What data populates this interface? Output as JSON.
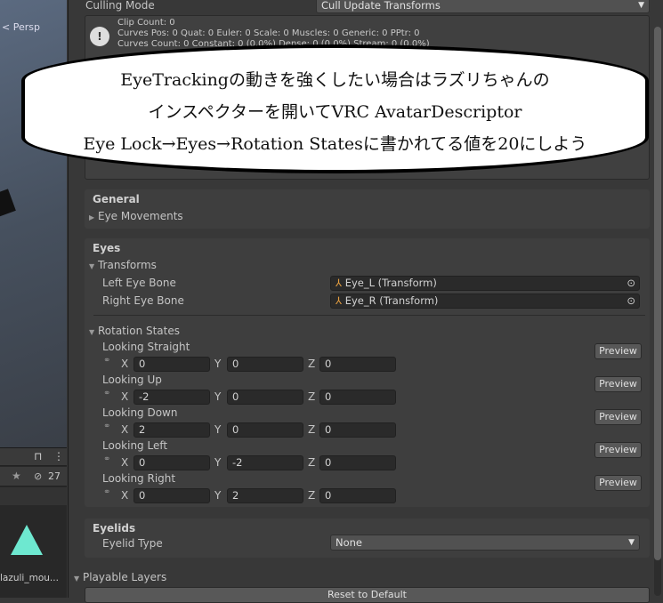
{
  "scene": {
    "persp_label": "< Persp"
  },
  "project": {
    "hidden_count": "27",
    "asset_name": "lazuli_mou..."
  },
  "inspector": {
    "culling_label": "Culling Mode",
    "culling_value": "Cull Update Transforms",
    "info": [
      "Clip Count: 0",
      "Curves Pos: 0 Quat: 0 Euler: 0 Scale: 0 Muscles: 0 Generic: 0 PPtr: 0",
      "Curves Count: 0 Constant: 0 (0.0%) Dense: 0 (0.0%) Stream: 0 (0.0%)"
    ],
    "general": {
      "title": "General",
      "eye_movements": "Eye Movements"
    },
    "eyes": {
      "title": "Eyes",
      "transforms": "Transforms",
      "left_label": "Left Eye Bone",
      "left_value": "Eye_L (Transform)",
      "right_label": "Right Eye Bone",
      "right_value": "Eye_R (Transform)",
      "rotation_states": "Rotation States",
      "preview": "Preview",
      "states": [
        {
          "label": "Looking Straight",
          "x": "0",
          "y": "0",
          "z": "0"
        },
        {
          "label": "Looking Up",
          "x": "-2",
          "y": "0",
          "z": "0"
        },
        {
          "label": "Looking Down",
          "x": "2",
          "y": "0",
          "z": "0"
        },
        {
          "label": "Looking Left",
          "x": "0",
          "y": "-2",
          "z": "0"
        },
        {
          "label": "Looking Right",
          "x": "0",
          "y": "2",
          "z": "0"
        }
      ]
    },
    "axis": {
      "x": "X",
      "y": "Y",
      "z": "Z"
    },
    "eyelids": {
      "title": "Eyelids",
      "type_label": "Eyelid Type",
      "type_value": "None"
    },
    "playable_layers": "Playable Layers",
    "reset": "Reset to Default"
  },
  "annotation": {
    "lines": [
      "EyeTrackingの動きを強くしたい場合はラズリちゃんの",
      "インスペクターを開いてVRC AvatarDescriptor",
      "Eye Lock→Eyes→Rotation Statesに書かれてる値を20にしよう"
    ]
  }
}
